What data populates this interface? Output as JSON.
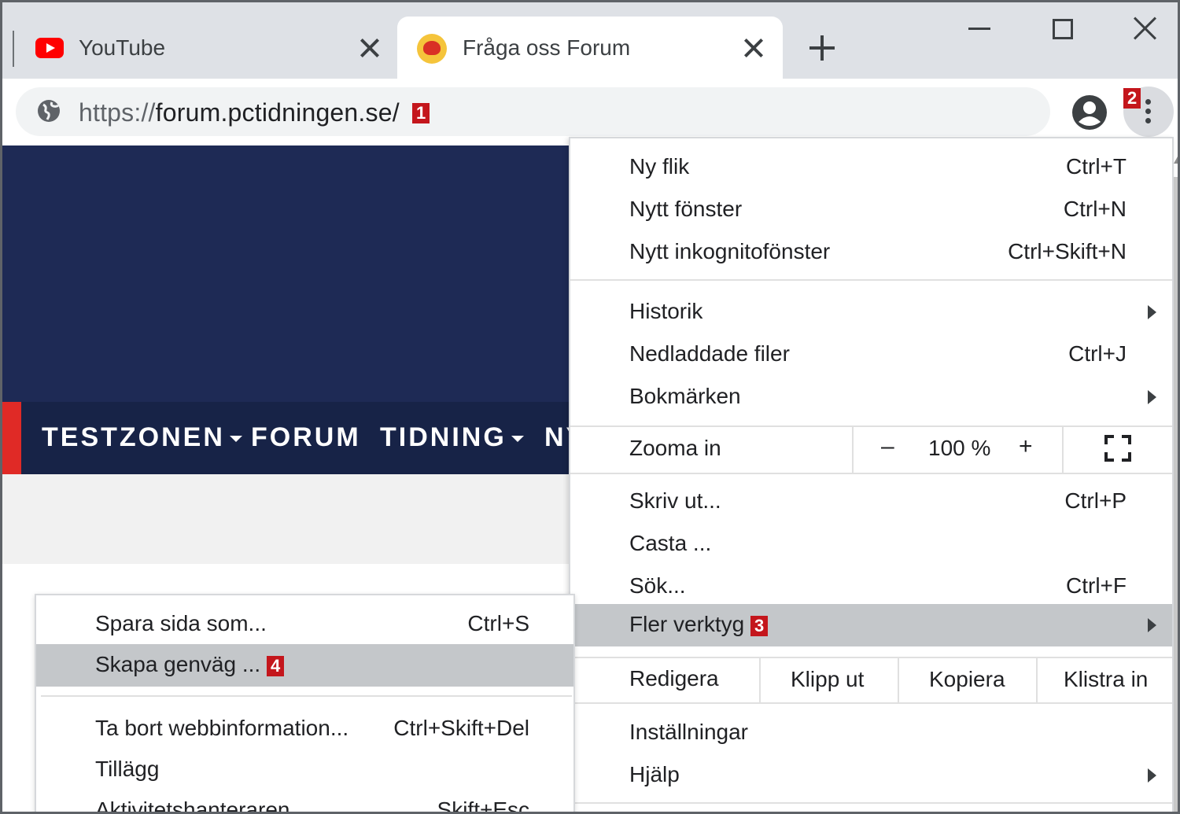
{
  "tabs": [
    {
      "title": "YouTube",
      "icon": "youtube-icon",
      "active": false
    },
    {
      "title": "Fråga oss Forum",
      "icon": "forum-favicon-icon",
      "active": true
    }
  ],
  "address_bar": {
    "scheme": "https://",
    "url_rest": "forum.pctidningen.se/",
    "badge": "1"
  },
  "toolbar": {
    "menu_badge": "2"
  },
  "site_nav": {
    "items": [
      {
        "label": "TESTZONEN",
        "dropdown": true
      },
      {
        "label": "FORUM",
        "dropdown": false
      },
      {
        "label": "TIDNING",
        "dropdown": true
      },
      {
        "label": "NY",
        "dropdown": false
      }
    ]
  },
  "main_menu": {
    "group1": [
      {
        "label": "Ny flik",
        "shortcut": "Ctrl+T"
      },
      {
        "label": "Nytt fönster",
        "shortcut": "Ctrl+N"
      },
      {
        "label": "Nytt inkognitofönster",
        "shortcut": "Ctrl+Skift+N"
      }
    ],
    "group2": [
      {
        "label": "Historik",
        "shortcut": "",
        "submenu": true
      },
      {
        "label": "Nedladdade filer",
        "shortcut": "Ctrl+J",
        "submenu": false
      },
      {
        "label": "Bokmärken",
        "shortcut": "",
        "submenu": true
      }
    ],
    "zoom": {
      "label": "Zooma in",
      "minus": "–",
      "value": "100 %",
      "plus": "+"
    },
    "group3": [
      {
        "label": "Skriv ut...",
        "shortcut": "Ctrl+P"
      },
      {
        "label": "Casta ...",
        "shortcut": ""
      },
      {
        "label": "Sök...",
        "shortcut": "Ctrl+F"
      }
    ],
    "more_tools": {
      "label": "Fler verktyg",
      "badge": "3"
    },
    "edit": {
      "label": "Redigera",
      "cut": "Klipp ut",
      "copy": "Kopiera",
      "paste": "Klistra in"
    },
    "group4": [
      {
        "label": "Inställningar",
        "submenu": false
      },
      {
        "label": "Hjälp",
        "submenu": true
      }
    ]
  },
  "sub_menu": {
    "items": [
      {
        "label": "Spara sida som...",
        "shortcut": "Ctrl+S",
        "badge": "",
        "highlight": false
      },
      {
        "label": "Skapa genväg ...",
        "shortcut": "",
        "badge": "4",
        "highlight": true
      },
      {
        "label": "Ta bort webbinformation...",
        "shortcut": "Ctrl+Skift+Del",
        "badge": "",
        "highlight": false
      },
      {
        "label": "Tillägg",
        "shortcut": "",
        "badge": "",
        "highlight": false
      },
      {
        "label": "Aktivitetshanteraren",
        "shortcut": "Skift+Esc",
        "badge": "",
        "highlight": false
      }
    ]
  },
  "colors": {
    "youtube_red": "#ff0000",
    "badge_red": "#c4161c",
    "hero_navy": "#1e2a55",
    "nav_navy": "#172347",
    "nav_accent": "#e02a26",
    "menu_highlight": "#c4c7ca"
  }
}
